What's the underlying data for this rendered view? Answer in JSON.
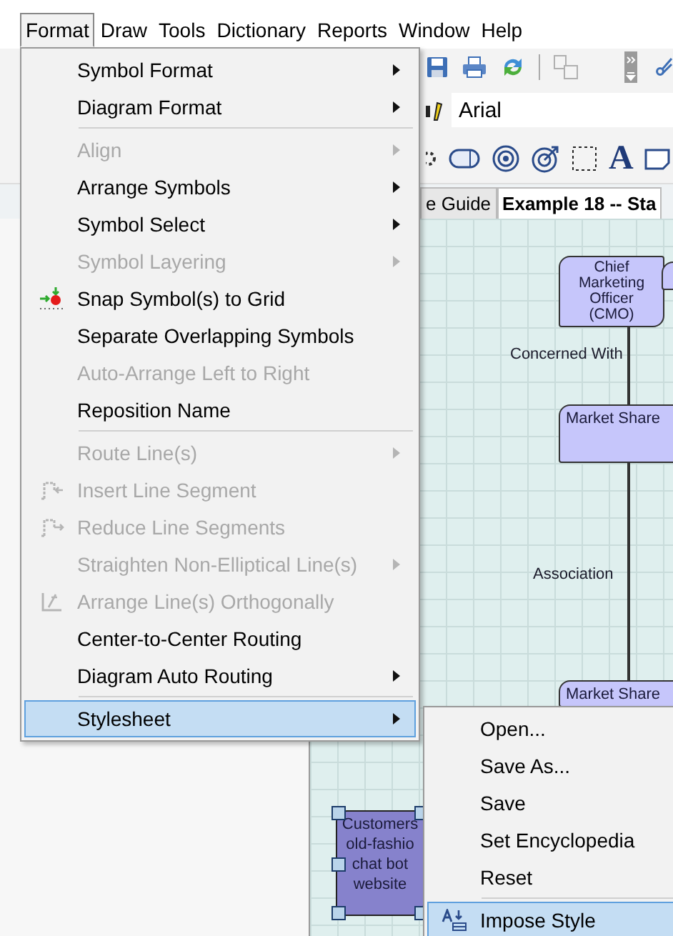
{
  "menubar": [
    {
      "label": "Format",
      "selected": true
    },
    {
      "label": "Draw",
      "selected": false
    },
    {
      "label": "Tools",
      "selected": false
    },
    {
      "label": "Dictionary",
      "selected": false
    },
    {
      "label": "Reports",
      "selected": false
    },
    {
      "label": "Window",
      "selected": false
    },
    {
      "label": "Help",
      "selected": false
    }
  ],
  "toolbar": {
    "font_field": {
      "value": "Arial"
    },
    "text_tool": "A"
  },
  "tabs": [
    {
      "label": "e Guide",
      "selected": false
    },
    {
      "label": "Example 18 -- Sta",
      "selected": true
    }
  ],
  "diagram": {
    "nodes": [
      {
        "lines": [
          "Chief",
          "Marketing",
          "Officer",
          "(CMO)"
        ],
        "selected": false
      },
      {
        "lines": [
          "Market Share"
        ],
        "selected": false
      },
      {
        "lines": [
          "Market Share"
        ],
        "selected": false
      },
      {
        "lines": [
          "Customers",
          "old-fashio",
          "chat bot",
          "website"
        ],
        "selected": true
      }
    ],
    "labels": [
      "Concerned With",
      "Association"
    ]
  },
  "format_menu": {
    "items": [
      {
        "kind": "item",
        "label": "Symbol Format",
        "disabled": false,
        "submenu": true,
        "selected": false
      },
      {
        "kind": "item",
        "label": "Diagram Format",
        "disabled": false,
        "submenu": true,
        "selected": false
      },
      {
        "kind": "separator"
      },
      {
        "kind": "item",
        "label": "Align",
        "disabled": true,
        "submenu": true,
        "selected": false
      },
      {
        "kind": "item",
        "label": "Arrange Symbols",
        "disabled": false,
        "submenu": true,
        "selected": false
      },
      {
        "kind": "item",
        "label": "Symbol Select",
        "disabled": false,
        "submenu": true,
        "selected": false
      },
      {
        "kind": "item",
        "label": "Symbol Layering",
        "disabled": true,
        "submenu": true,
        "selected": false
      },
      {
        "kind": "item",
        "label": "Snap Symbol(s) to Grid",
        "disabled": false,
        "submenu": false,
        "selected": false
      },
      {
        "kind": "item",
        "label": "Separate Overlapping Symbols",
        "disabled": false,
        "submenu": false,
        "selected": false
      },
      {
        "kind": "item",
        "label": "Auto-Arrange Left to Right",
        "disabled": true,
        "submenu": false,
        "selected": false
      },
      {
        "kind": "item",
        "label": "Reposition Name",
        "disabled": false,
        "submenu": false,
        "selected": false
      },
      {
        "kind": "separator"
      },
      {
        "kind": "item",
        "label": "Route Line(s)",
        "disabled": true,
        "submenu": true,
        "selected": false
      },
      {
        "kind": "item",
        "label": "Insert Line Segment",
        "disabled": true,
        "submenu": false,
        "selected": false
      },
      {
        "kind": "item",
        "label": "Reduce Line Segments",
        "disabled": true,
        "submenu": false,
        "selected": false
      },
      {
        "kind": "item",
        "label": "Straighten Non-Elliptical Line(s)",
        "disabled": true,
        "submenu": true,
        "selected": false
      },
      {
        "kind": "item",
        "label": "Arrange Line(s) Orthogonally",
        "disabled": true,
        "submenu": false,
        "selected": false
      },
      {
        "kind": "item",
        "label": "Center-to-Center Routing",
        "disabled": false,
        "submenu": false,
        "selected": false
      },
      {
        "kind": "item",
        "label": "Diagram Auto Routing",
        "disabled": false,
        "submenu": true,
        "selected": false
      },
      {
        "kind": "separator"
      },
      {
        "kind": "item",
        "label": "Stylesheet",
        "disabled": false,
        "submenu": true,
        "selected": true
      }
    ]
  },
  "stylesheet_submenu": {
    "items": [
      {
        "kind": "item",
        "label": "Open...",
        "selected": false
      },
      {
        "kind": "item",
        "label": "Save As...",
        "selected": false
      },
      {
        "kind": "item",
        "label": "Save",
        "selected": false
      },
      {
        "kind": "item",
        "label": "Set Encyclopedia",
        "selected": false
      },
      {
        "kind": "item",
        "label": "Reset",
        "selected": false
      },
      {
        "kind": "separator"
      },
      {
        "kind": "item",
        "label": "Impose Style",
        "selected": true
      }
    ]
  }
}
